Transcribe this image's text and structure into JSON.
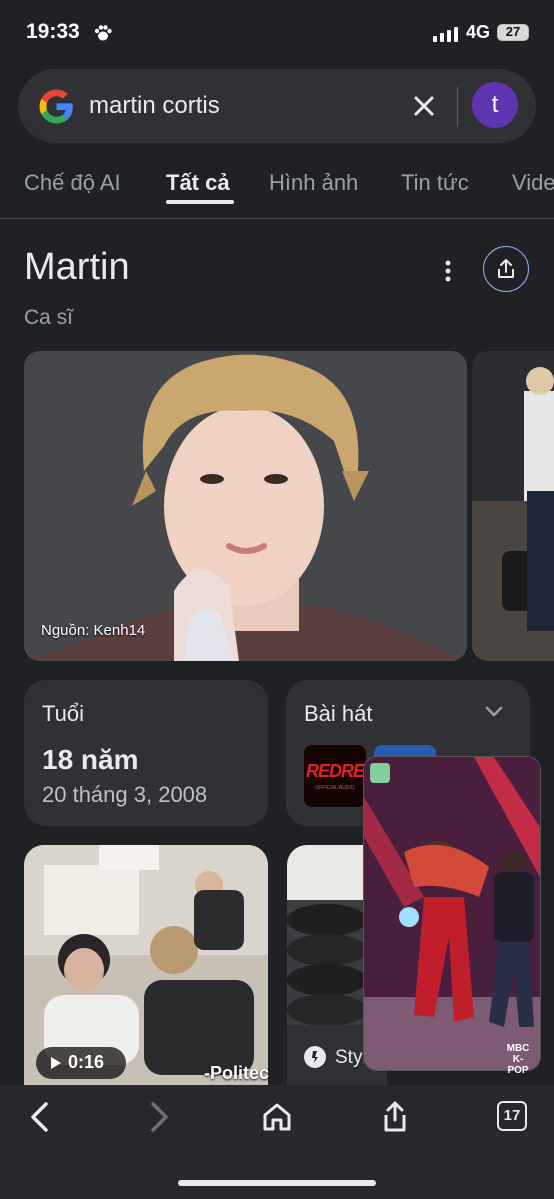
{
  "status": {
    "time": "19:33",
    "network": "4G",
    "battery": "27"
  },
  "search": {
    "query": "martin cortis",
    "avatar_letter": "t"
  },
  "tabs": [
    {
      "label": "Chế độ AI"
    },
    {
      "label": "Tất cả",
      "active": true
    },
    {
      "label": "Hình ảnh"
    },
    {
      "label": "Tin tức"
    },
    {
      "label": "Vide"
    }
  ],
  "knowledge_panel": {
    "title": "Martin",
    "subtitle": "Ca sĩ",
    "image_credit": "Nguồn: Kenh14",
    "age_card": {
      "label": "Tuổi",
      "value": "18 năm",
      "date": "20 tháng 3, 2008"
    },
    "songs_card": {
      "label": "Bài hát",
      "album_text": "REDRE",
      "album_subtext": "OFFICIAL AUDIO"
    }
  },
  "videos": [
    {
      "duration": "0:16",
      "overlay_text": "-Politec"
    },
    {
      "source": "Styl"
    }
  ],
  "pip": {
    "logo": "MBC K-POP"
  },
  "toolbar": {
    "tab_count": "17"
  },
  "colors": {
    "background": "#202124",
    "surface": "#303134",
    "accent": "#8ab4f8",
    "avatar": "#5e35b1"
  }
}
